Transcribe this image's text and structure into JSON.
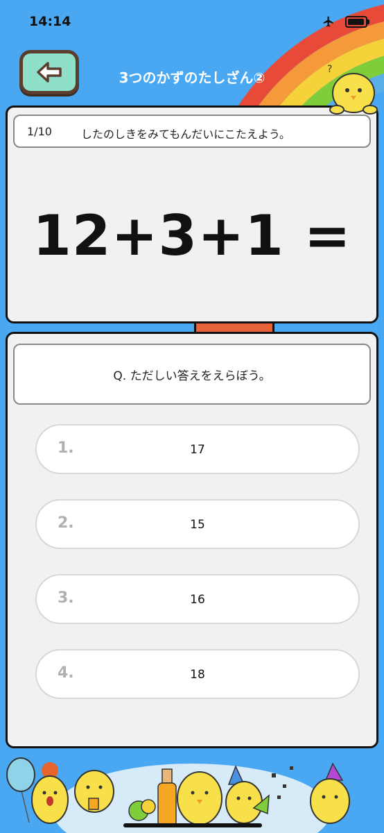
{
  "status": {
    "time": "14:14"
  },
  "header": {
    "title": "3つのかずのたしざん②"
  },
  "problem": {
    "counter": "1/10",
    "instruction": "したのしきをみてもんだいにこたえよう。",
    "equation": "12+3+1 ="
  },
  "question": {
    "prompt": "Q. ただしい答えをえらぼう。",
    "answers": [
      {
        "num": "1.",
        "value": "17"
      },
      {
        "num": "2.",
        "value": "15"
      },
      {
        "num": "3.",
        "value": "16"
      },
      {
        "num": "4.",
        "value": "18"
      }
    ]
  },
  "colors": {
    "background": "#4aa8f2",
    "back_button": "#8fe0c8",
    "back_button_border": "#5b3d2e",
    "panel": "#f1f1f1"
  },
  "icons": {
    "back": "back-arrow-icon",
    "airplane": "airplane-icon",
    "battery": "battery-icon"
  },
  "battery_level": 0.95
}
